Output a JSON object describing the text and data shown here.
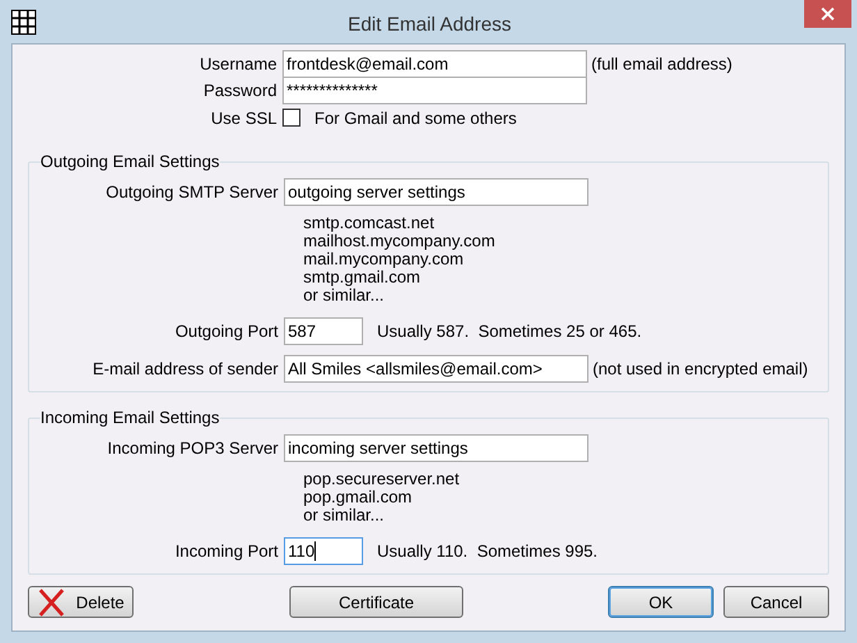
{
  "window": {
    "title": "Edit Email Address"
  },
  "account": {
    "fields": [
      {
        "label": "Username",
        "value": "frontdesk@email.com",
        "note": "(full email address)"
      },
      {
        "label": "Password",
        "value": "**************"
      }
    ],
    "use_ssl": {
      "label": "Use SSL",
      "checked": false,
      "note": "For Gmail and some others"
    }
  },
  "groups": [
    {
      "title": "Outgoing Email Settings",
      "server": {
        "label": "Outgoing SMTP Server",
        "value": "outgoing server settings"
      },
      "examples": [
        "smtp.comcast.net",
        "mailhost.mycompany.com",
        "mail.mycompany.com",
        "smtp.gmail.com",
        "or similar..."
      ],
      "fields": [
        {
          "label": "Outgoing Port",
          "value": "587",
          "note": "Usually 587.  Sometimes 25 or 465.",
          "kind": "short",
          "focused": false
        },
        {
          "label": "E-mail address of sender",
          "value": "All Smiles <allsmiles@email.com>",
          "note": "(not used in encrypted email)",
          "kind": "wide",
          "focused": false
        }
      ]
    },
    {
      "title": "Incoming Email Settings",
      "server": {
        "label": "Incoming POP3 Server",
        "value": "incoming server settings"
      },
      "examples": [
        "pop.secureserver.net",
        "pop.gmail.com",
        "or similar..."
      ],
      "fields": [
        {
          "label": "Incoming Port",
          "value": "110",
          "note": "Usually 110.  Sometimes 995.",
          "kind": "short",
          "focused": true
        }
      ]
    }
  ],
  "buttons": [
    {
      "label": "Delete",
      "kind": "delete"
    },
    {
      "label": "Certificate",
      "kind": "plain"
    },
    {
      "label": "OK",
      "kind": "default"
    },
    {
      "label": "Cancel",
      "kind": "plain"
    }
  ]
}
